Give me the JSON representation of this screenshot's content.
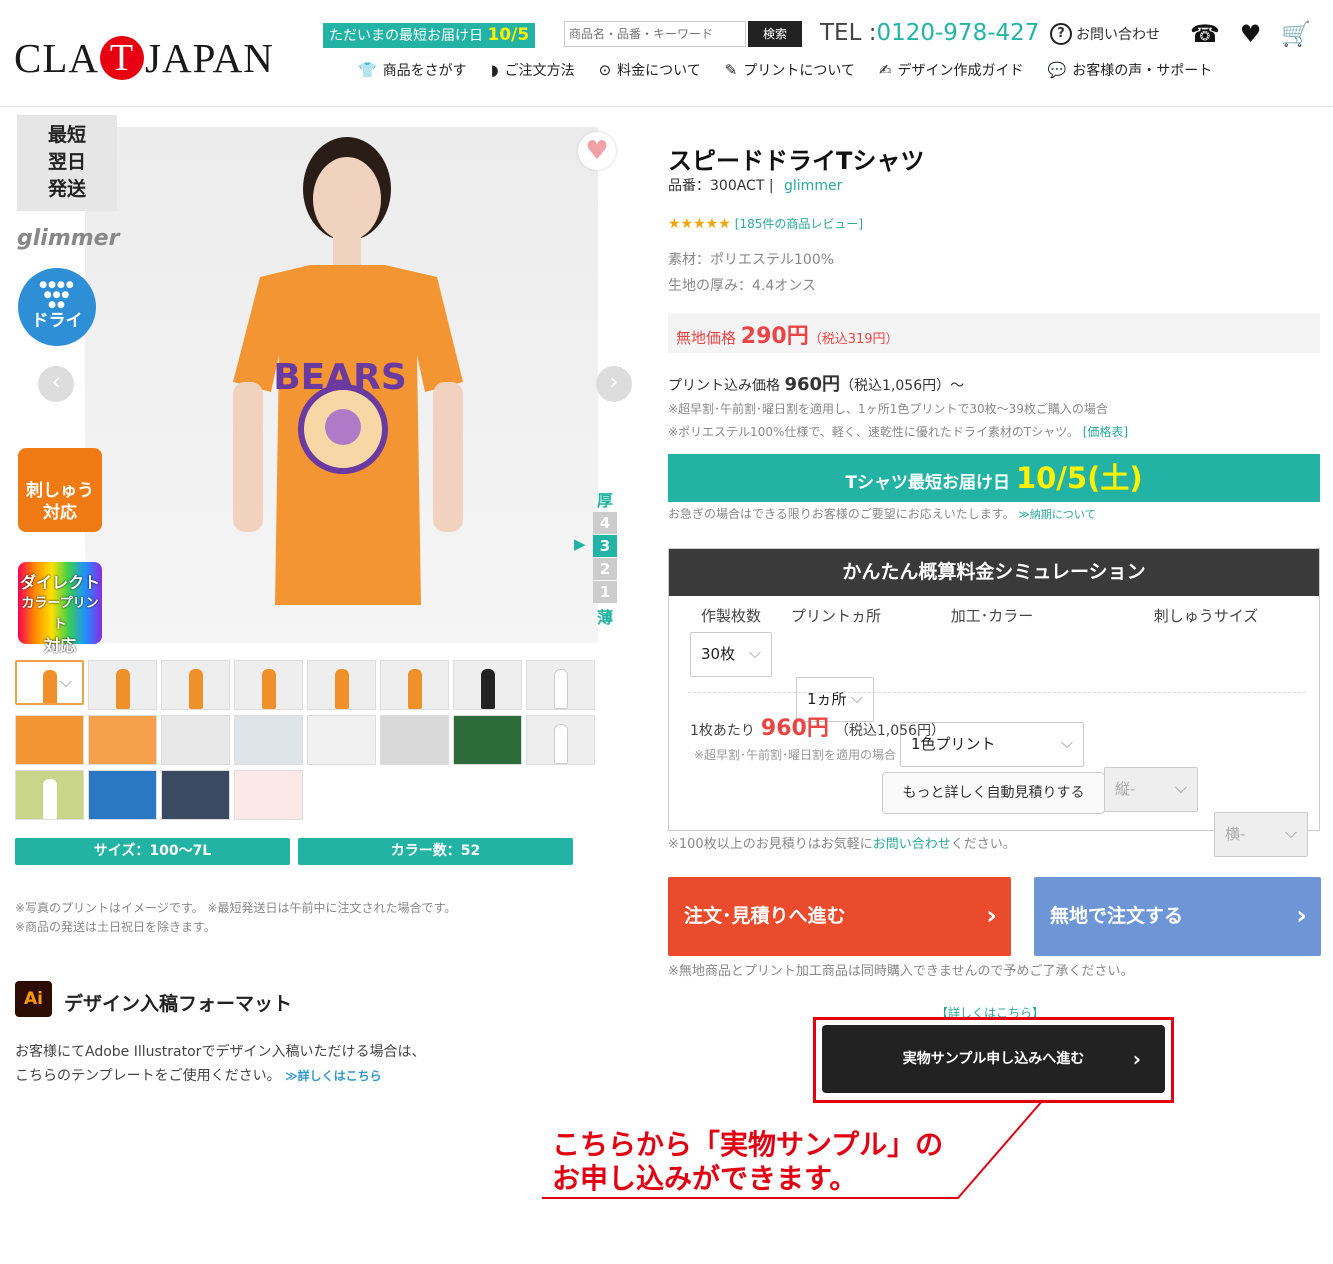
{
  "header": {
    "logo": {
      "pre": "CLA",
      "t": "T",
      "post": "JAPAN"
    },
    "delivery": {
      "label": "ただいまの最短お届け日",
      "date": "10/5"
    },
    "search": {
      "placeholder": "商品名・品番・キーワード",
      "button": "検索"
    },
    "tel": {
      "label": "TEL :",
      "number": "0120-978-427"
    },
    "contact": "お問い合わせ",
    "icons": [
      "phone-icon",
      "heart-icon",
      "cart-icon"
    ],
    "nav": [
      {
        "icon": "tshirt-icon",
        "label": "商品をさがす"
      },
      {
        "icon": "leaf-icon",
        "label": "ご注文方法"
      },
      {
        "icon": "yen-icon",
        "label": "料金について"
      },
      {
        "icon": "brush-icon",
        "label": "プリントについて"
      },
      {
        "icon": "pen-icon",
        "label": "デザイン作成ガイド"
      },
      {
        "icon": "chat-icon",
        "label": "お客様の声・サポート"
      }
    ]
  },
  "gallery": {
    "badges": {
      "fast": [
        "最短",
        "翌日",
        "発送"
      ],
      "brand": "glimmer",
      "dry": "ドライ",
      "embroidery": [
        "刺しゅう",
        "対応"
      ],
      "direct": [
        "ダイレクト",
        "カラープリント",
        "対応"
      ]
    },
    "thickness": {
      "top": "厚",
      "bottom": "薄",
      "levels": [
        "4",
        "3",
        "2",
        "1"
      ],
      "current": "3"
    },
    "size_pill": "サイズ：100～7L",
    "color_pill": "カラー数：52",
    "notes": [
      "※写真のプリントはイメージです。 ※最短発送日は午前中に注文された場合です。",
      "※商品の発送は土日祝日を除きます。"
    ]
  },
  "ai": {
    "icon": "Ai",
    "title": "デザイン入稿フォーマット",
    "desc1": "お客様にてAdobe Illustratorでデザイン入稿いただける場合は、",
    "desc2": "こちらのテンプレートをご使用ください。",
    "link": "≫詳しくはこちら"
  },
  "product": {
    "title": "スピードドライTシャツ",
    "code": "品番：300ACT",
    "brand": "glimmer",
    "stars": "★★★★★",
    "reviews": "[185件の商品レビュー]",
    "material": "素材：ポリエステル100%",
    "thickness": "生地の厚み：4.4オンス",
    "blank_price_label": "無地価格",
    "blank_price": "290円",
    "blank_price_tax": "（税込319円）",
    "print_price_label": "プリント込み価格",
    "print_price": "960円",
    "print_price_tax": "（税込1,056円）～",
    "note1": "※超早割･午前割･曜日割を適用し、1ヶ所1色プリントで30枚～39枚ご購入の場合",
    "note2": "※ポリエステル100%仕様で、軽く、速乾性に優れたドライ素材のTシャツ。",
    "price_table_link": "[価格表]",
    "banner_label": "Tシャツ最短お届け日",
    "banner_date": "10/5(土)",
    "banner_note": "お急ぎの場合はできる限りお客様のご要望にお応えいたします。",
    "banner_link": "≫納期について"
  },
  "simulator": {
    "title": "かんたん概算料金シミュレーション",
    "labels": {
      "qty": "作製枚数",
      "places": "プリントヵ所",
      "color": "加工･カラー",
      "emb": "刺しゅうサイズ"
    },
    "values": {
      "qty": "30枚",
      "places": "1ヵ所",
      "color": "1色プリント",
      "emb_v": "縦-",
      "emb_h": "横-"
    },
    "per_label": "1枚あたり",
    "per_price": "960円",
    "per_tax": "（税込1,056円）",
    "per_note": "※超早割･午前割･曜日割を適用の場合",
    "detail_button": "もっと詳しく自動見積りする",
    "bottom_note": "※100枚以上のお見積りはお気軽に",
    "bottom_link": "お問い合わせ",
    "bottom_tail": "ください。"
  },
  "actions": {
    "order": "注文･見積りへ進む",
    "blank": "無地で注文する",
    "note": "※無地商品とプリント加工商品は同時購入できませんので予めご了承ください。",
    "more": "【詳しくはこちら】",
    "sample": "実物サンプル申し込みへ進む"
  },
  "callout": [
    "こちらから「実物サンプル」の",
    "お申し込みができます。"
  ],
  "colors": {
    "teal": "#22b3a5",
    "red": "#e94545",
    "orange": "#e94b2c",
    "blue": "#6e96d6"
  }
}
